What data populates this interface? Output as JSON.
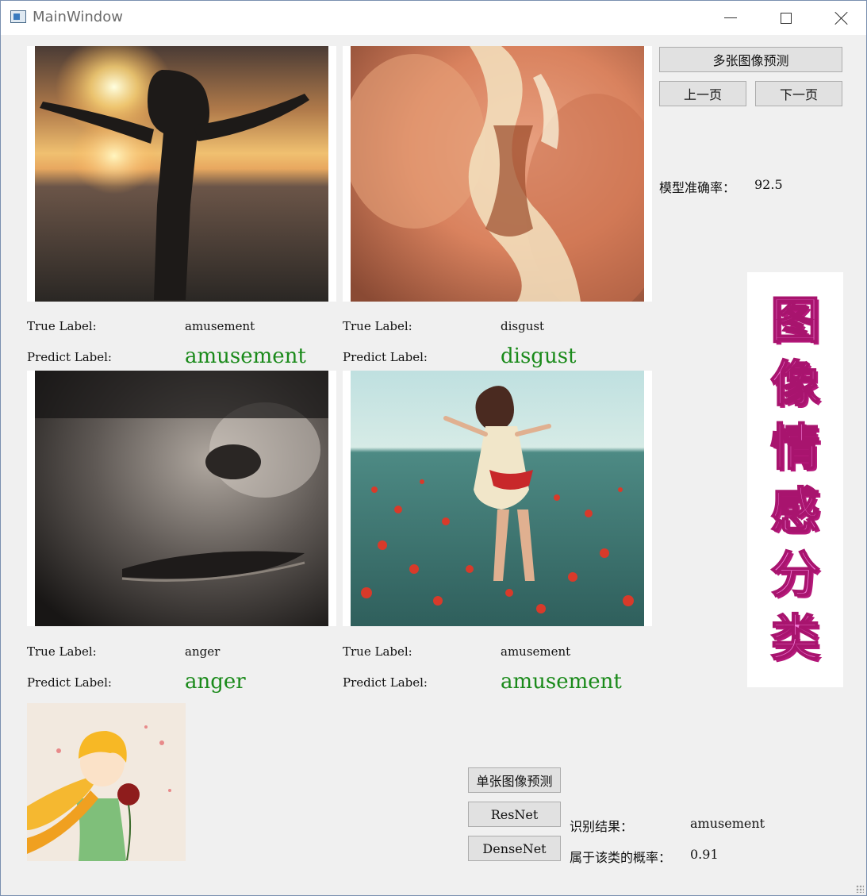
{
  "window": {
    "title": "MainWindow"
  },
  "grid": [
    {
      "true_label_caption": "True Label:",
      "true_label": "amusement",
      "predict_caption": "Predict Label:",
      "predict_label": "amusement"
    },
    {
      "true_label_caption": "True Label:",
      "true_label": "disgust",
      "predict_caption": "Predict Label:",
      "predict_label": "disgust"
    },
    {
      "true_label_caption": "True Label:",
      "true_label": "anger",
      "predict_caption": "Predict Label:",
      "predict_label": "anger"
    },
    {
      "true_label_caption": "True Label:",
      "true_label": "amusement",
      "predict_caption": "Predict Label:",
      "predict_label": "amusement"
    }
  ],
  "controls": {
    "multi_predict": "多张图像预测",
    "prev_page": "上一页",
    "next_page": "下一页",
    "accuracy_caption": "模型准确率：",
    "accuracy_value": "92.5"
  },
  "banner": {
    "chars": [
      "图",
      "像",
      "情",
      "感",
      "分",
      "类"
    ]
  },
  "single": {
    "single_predict": "单张图像预测",
    "resnet": "ResNet",
    "densenet": "DenseNet",
    "result_caption": "识别结果：",
    "result_value": "amusement",
    "prob_caption": "属于该类的概率：",
    "prob_value": "0.91"
  }
}
